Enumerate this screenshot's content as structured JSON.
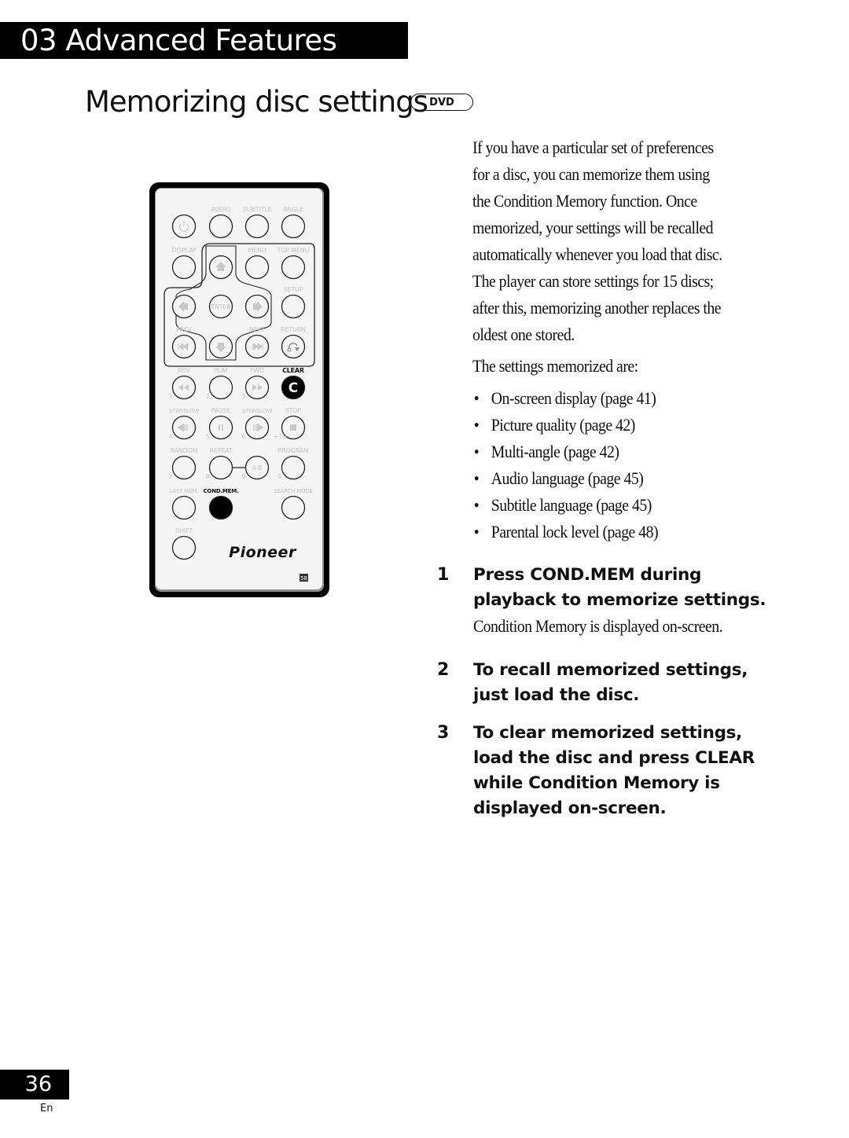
{
  "header": {
    "chapter": "03 Advanced Features"
  },
  "section": {
    "title": "Memorizing disc settings",
    "badge": "DVD"
  },
  "remote": {
    "brand": "Pioneer",
    "code": "58",
    "buttons": [
      {
        "label": "",
        "number": "",
        "icon": "power-icon",
        "col": 0,
        "row": 0,
        "highlight": false
      },
      {
        "label": "AUDIO",
        "number": "",
        "icon": "",
        "col": 1,
        "row": 0,
        "highlight": false
      },
      {
        "label": "SUBTITLE",
        "number": "",
        "icon": "",
        "col": 2,
        "row": 0,
        "highlight": false
      },
      {
        "label": "ANGLE",
        "number": "",
        "icon": "",
        "col": 3,
        "row": 0,
        "highlight": false
      },
      {
        "label": "DISPLAY",
        "number": "",
        "icon": "",
        "col": 0,
        "row": 1,
        "highlight": false
      },
      {
        "label": "",
        "number": "",
        "icon": "arrow-up-icon",
        "col": 1,
        "row": 1,
        "highlight": false
      },
      {
        "label": "MENU",
        "number": "",
        "icon": "",
        "col": 2,
        "row": 1,
        "highlight": false
      },
      {
        "label": "TOP MENU",
        "number": "",
        "icon": "",
        "col": 3,
        "row": 1,
        "highlight": false
      },
      {
        "label": "",
        "number": "",
        "icon": "arrow-left-icon",
        "col": 0,
        "row": 2,
        "highlight": false
      },
      {
        "label": "",
        "number": "",
        "icon": "enter-icon",
        "inner": "ENTER",
        "col": 1,
        "row": 2,
        "highlight": false
      },
      {
        "label": "",
        "number": "",
        "icon": "arrow-right-icon",
        "col": 2,
        "row": 2,
        "highlight": false
      },
      {
        "label": "SETUP",
        "number": "",
        "icon": "",
        "col": 3,
        "row": 2,
        "highlight": false
      },
      {
        "label": "PREV",
        "number": "",
        "icon": "prev-icon",
        "col": 0,
        "row": 3,
        "highlight": false
      },
      {
        "label": "",
        "number": "",
        "icon": "arrow-down-icon",
        "col": 1,
        "row": 3,
        "highlight": false
      },
      {
        "label": "NEXT",
        "number": "",
        "icon": "next-icon",
        "col": 2,
        "row": 3,
        "highlight": false
      },
      {
        "label": "RETURN",
        "number": "",
        "icon": "return-icon",
        "col": 3,
        "row": 3,
        "highlight": false
      },
      {
        "label": "REV",
        "number": "1",
        "icon": "rewind-icon",
        "col": 0,
        "row": 4,
        "highlight": false
      },
      {
        "label": "PLAY",
        "number": "2",
        "icon": "",
        "col": 1,
        "row": 4,
        "highlight": false
      },
      {
        "label": "FWD",
        "number": "3",
        "icon": "fast-forward-icon",
        "col": 2,
        "row": 4,
        "highlight": false
      },
      {
        "label": "CLEAR",
        "number": "",
        "icon": "clear-icon",
        "inner": "C",
        "col": 3,
        "row": 4,
        "highlight": true
      },
      {
        "label": "STEP/SLOW",
        "number": "4",
        "icon": "step-back-icon",
        "col": 0,
        "row": 5,
        "highlight": false
      },
      {
        "label": "PAUSE",
        "number": "5",
        "icon": "pause-icon",
        "col": 1,
        "row": 5,
        "highlight": false
      },
      {
        "label": "STEP/SLOW",
        "number": "6",
        "icon": "step-forward-icon",
        "col": 2,
        "row": 5,
        "highlight": false
      },
      {
        "label": "STOP",
        "number": "+10",
        "icon": "stop-icon",
        "col": 3,
        "row": 5,
        "highlight": false
      },
      {
        "label": "RANDOM",
        "number": "7",
        "icon": "",
        "col": 0,
        "row": 6,
        "highlight": false
      },
      {
        "label": "REPEAT",
        "number": "8",
        "icon": "",
        "col": 1,
        "row": 6,
        "highlight": false
      },
      {
        "label": "",
        "number": "9",
        "icon": "",
        "inner": "A-B",
        "col": 2,
        "row": 6,
        "highlight": false
      },
      {
        "label": "PROGRAM",
        "number": "0",
        "icon": "",
        "col": 3,
        "row": 6,
        "highlight": false
      },
      {
        "label": "LAST MEM.",
        "number": "",
        "icon": "",
        "col": 0,
        "row": 7,
        "highlight": false
      },
      {
        "label": "COND.MEM.",
        "number": "",
        "icon": "",
        "col": 1,
        "row": 7,
        "highlight": true
      },
      {
        "label": "SEARCH MODE",
        "number": "",
        "icon": "",
        "col": 3,
        "row": 7,
        "highlight": false
      },
      {
        "label": "SHIFT",
        "number": "",
        "icon": "",
        "col": 0,
        "row": 8,
        "highlight": false
      }
    ]
  },
  "intro": {
    "lines": [
      "If you have a particular set of preferences",
      "for a disc, you can memorize them using",
      "the Condition Memory function. Once",
      "memorized, your settings will be recalled",
      "automatically whenever you load that disc.",
      "The player can store settings for 15 discs;",
      "after this, memorizing another replaces the",
      "oldest one stored."
    ],
    "settings_intro": "The settings memorized are:",
    "bullet": "•",
    "settings": [
      "On-screen display (page 41)",
      "Picture quality (page 42)",
      "Multi-angle (page 42)",
      "Audio language (page 45)",
      "Subtitle language (page 45)",
      "Parental lock level (page 48)"
    ]
  },
  "steps": [
    {
      "number": "1",
      "lines": [
        "Press COND.MEM during",
        "playback to memorize settings."
      ],
      "note": "Condition Memory is displayed on-screen."
    },
    {
      "number": "2",
      "lines": [
        "To recall memorized settings,",
        "just load the disc."
      ],
      "note": ""
    },
    {
      "number": "3",
      "lines": [
        "To clear memorized settings,",
        "load the disc and press CLEAR",
        "while Condition Memory is",
        "displayed on-screen."
      ],
      "note": ""
    }
  ],
  "footer": {
    "page_number": "36",
    "language": "En"
  }
}
